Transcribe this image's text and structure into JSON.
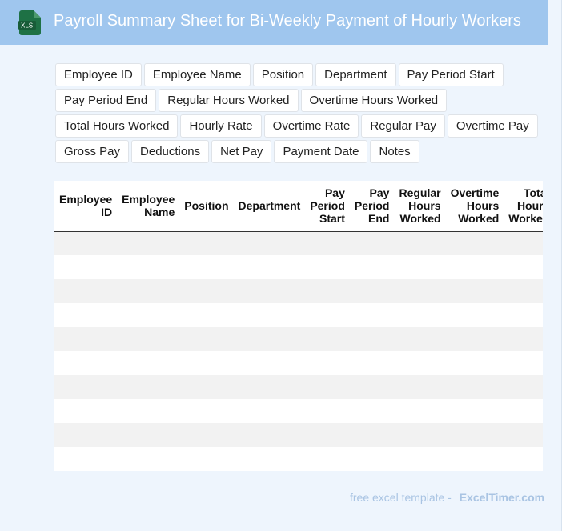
{
  "header": {
    "title": "Payroll Summary Sheet for Bi-Weekly Payment of Hourly Workers",
    "icon_label": "XLS",
    "icon_color": "#1e7145"
  },
  "chip_rows": [
    [
      "Employee ID",
      "Employee Name",
      "Position",
      "Department",
      "Pay Period Start"
    ],
    [
      "Pay Period End",
      "Regular Hours Worked",
      "Overtime Hours Worked"
    ],
    [
      "Total Hours Worked",
      "Hourly Rate",
      "Overtime Rate",
      "Regular Pay",
      "Overtime Pay"
    ],
    [
      "Gross Pay",
      "Deductions",
      "Net Pay",
      "Payment Date",
      "Notes"
    ]
  ],
  "table": {
    "columns": [
      [
        "Employee",
        "ID"
      ],
      [
        "Employee",
        "Name"
      ],
      [
        "Position"
      ],
      [
        "Department"
      ],
      [
        "Pay",
        "Period",
        "Start"
      ],
      [
        "Pay",
        "Period",
        "End"
      ],
      [
        "Regular",
        "Hours",
        "Worked"
      ],
      [
        "Overtime",
        "Hours",
        "Worked"
      ],
      [
        "Total",
        "Hours",
        "Worked"
      ]
    ],
    "empty_rows": 10
  },
  "footer": {
    "text": "free excel template -",
    "brand": "ExcelTimer.com"
  }
}
